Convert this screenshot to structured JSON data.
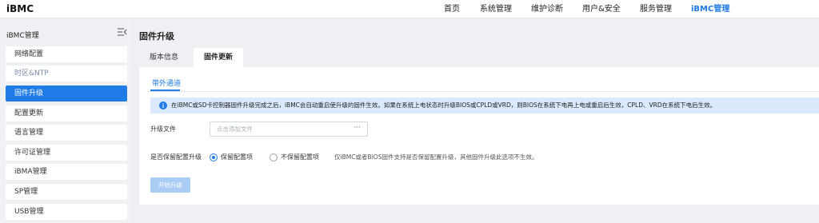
{
  "header": {
    "logo": "iBMC",
    "nav": [
      "首页",
      "系统管理",
      "维护诊断",
      "用户&安全",
      "服务管理",
      "iBMC管理"
    ],
    "active_nav": "iBMC管理"
  },
  "sidebar": {
    "title": "iBMC管理",
    "collapse_icon": "menu-collapse-icon",
    "items": [
      {
        "label": "网络配置"
      },
      {
        "label": "时区&NTP"
      },
      {
        "label": "固件升级"
      },
      {
        "label": "配置更新"
      },
      {
        "label": "语言管理"
      },
      {
        "label": "许可证管理"
      },
      {
        "label": "iBMA管理"
      },
      {
        "label": "SP管理"
      },
      {
        "label": "USB管理"
      }
    ],
    "active_item": "固件升级"
  },
  "main": {
    "title": "固件升级",
    "tabs": [
      {
        "label": "版本信息"
      },
      {
        "label": "固件更新"
      }
    ],
    "active_tab": "固件更新",
    "subtab": "带外通道",
    "notice": {
      "icon": "info-icon",
      "text": "在iBMC或SD卡控制器固件升级完成之后，iBMC会自动重启使升级的固件生效。如果在系统上电状态时升级BIOS或CPLD或VRD，则BIOS在系统下电再上电或重启后生效，CPLD、VRD在系统下电后生效。"
    },
    "upgrade_file": {
      "label": "升级文件",
      "placeholder": "点击添加文件",
      "browse_icon": "more-dots-icon"
    },
    "preserve_config": {
      "label": "是否保留配置升级",
      "options": [
        {
          "label": "保留配置项"
        },
        {
          "label": "不保留配置项"
        }
      ],
      "selected": "保留配置项",
      "hint": "仅iBMC或者BIOS固件支持是否保留配置升级，其他固件升级此选项不生效。"
    },
    "start_button": "开始升级"
  },
  "colors": {
    "accent": "#1f7be6",
    "notice_bg": "#dbe9fd",
    "disabled_button": "#a9cdf4",
    "page_bg": "#eef0f3"
  }
}
